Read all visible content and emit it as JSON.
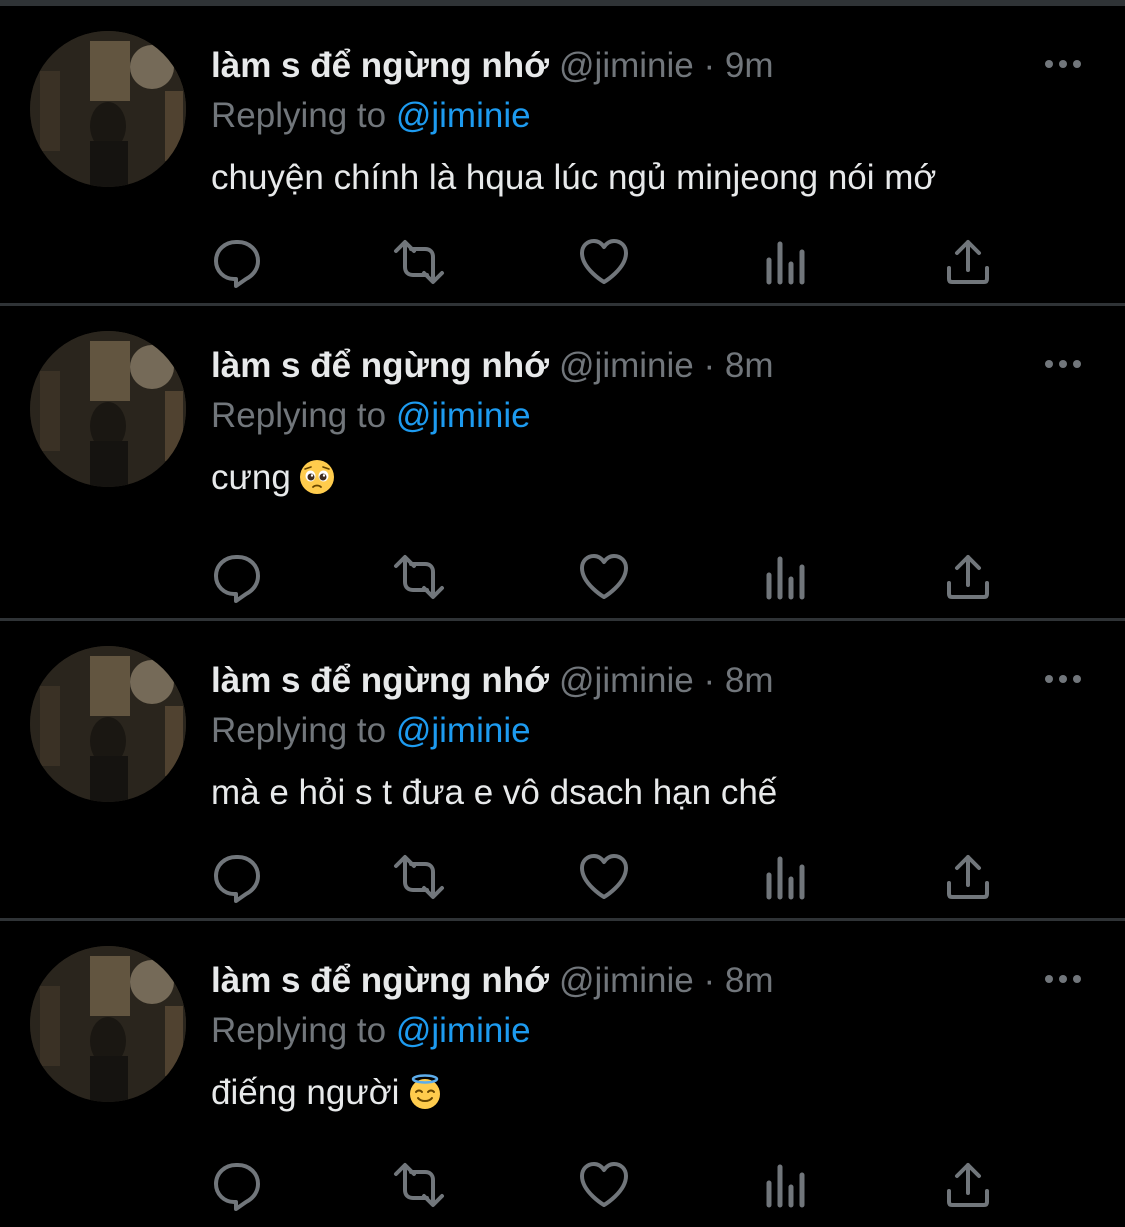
{
  "colors": {
    "background": "#000000",
    "divider": "#2f3336",
    "primary_text": "#e7e9ea",
    "secondary_text": "#71767b",
    "accent": "#1d9bf0"
  },
  "tweets": [
    {
      "display_name": "làm s để ngừng nhớ",
      "handle": "@jiminie",
      "time": "9m",
      "replying_label": "Replying to",
      "replying_handle": "@jiminie",
      "text": "chuyện chính là hqua lúc ngủ minjeong nói mớ",
      "emoji": ""
    },
    {
      "display_name": "làm s để ngừng nhớ",
      "handle": "@jiminie",
      "time": "8m",
      "replying_label": "Replying to",
      "replying_handle": "@jiminie",
      "text": "cưng",
      "emoji": "pleading-face-icon"
    },
    {
      "display_name": "làm s để ngừng nhớ",
      "handle": "@jiminie",
      "time": "8m",
      "replying_label": "Replying to",
      "replying_handle": "@jiminie",
      "text": "mà e hỏi s t đưa e vô dsach hạn chế",
      "emoji": ""
    },
    {
      "display_name": "làm s để ngừng nhớ",
      "handle": "@jiminie",
      "time": "8m",
      "replying_label": "Replying to",
      "replying_handle": "@jiminie",
      "text": "điếng người",
      "emoji": "halo-face-icon"
    }
  ],
  "action_icons": [
    "reply-icon",
    "retweet-icon",
    "like-icon",
    "views-icon",
    "share-icon"
  ]
}
